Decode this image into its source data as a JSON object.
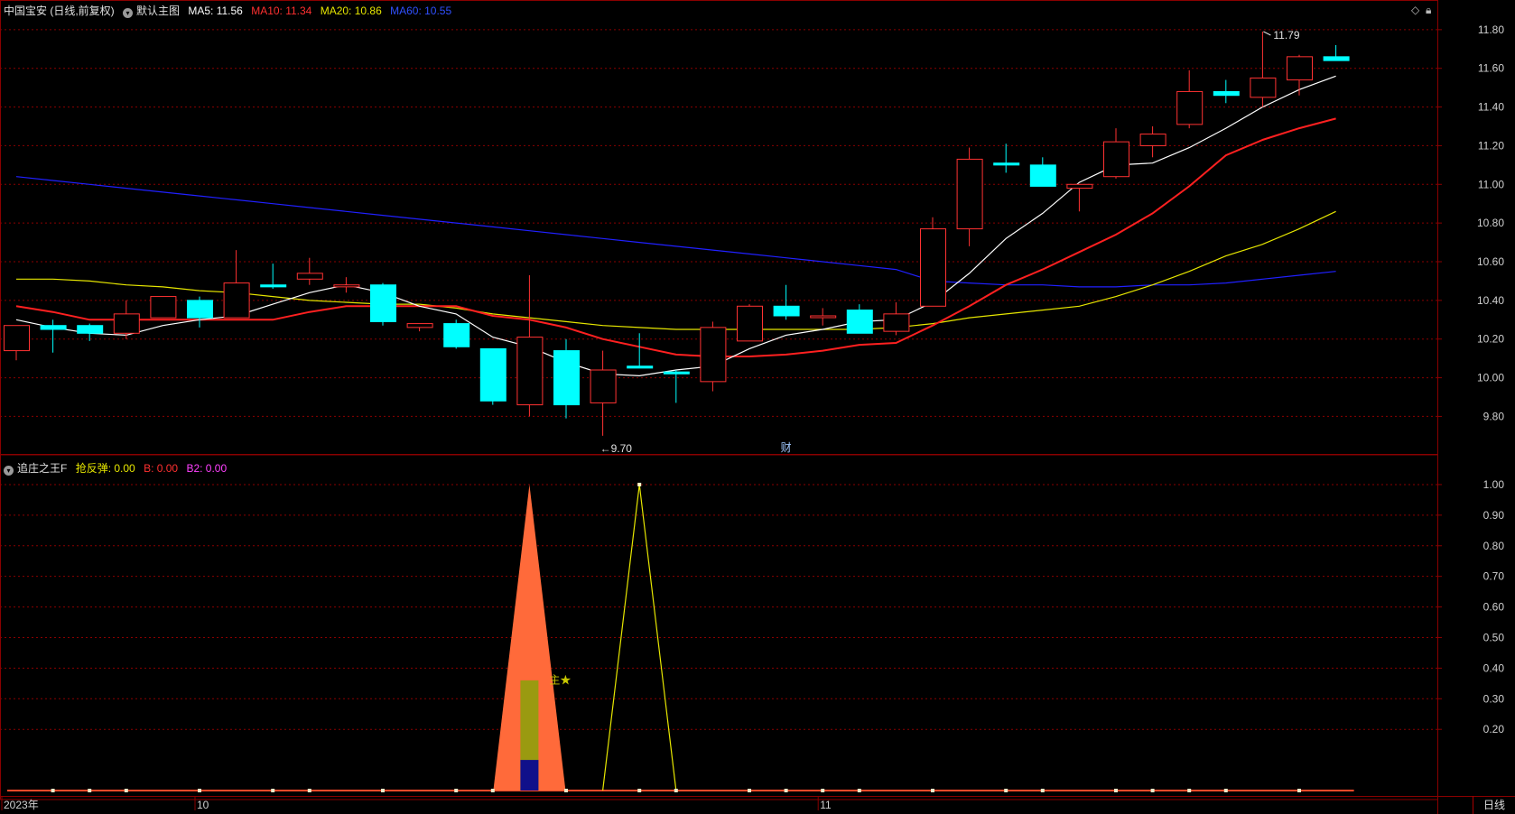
{
  "main_legend": {
    "title": "中国宝安 (日线,前复权)",
    "template": "默认主图",
    "ma5": "MA5: 11.56",
    "ma10": "MA10: 11.34",
    "ma20": "MA20: 10.86",
    "ma60": "MA60: 10.55"
  },
  "sub_legend": {
    "title": "追庄之王F",
    "qfd": "抢反弹: 0.00",
    "b": "B: 0.00",
    "b2": "B2: 0.00"
  },
  "period_label": "日线",
  "icons": [
    "diamond-icon",
    "lock-icon",
    "chevron-down-icon"
  ],
  "colors": {
    "up": "#ff3232",
    "down": "#00ffff",
    "ma5": "#ffffff",
    "ma10": "#ff2020",
    "ma20": "#e6e600",
    "ma60": "#2020ff",
    "grid": "#8a0000"
  },
  "chart_data": {
    "type": "candlestick",
    "price_axis": [
      "11.80",
      "11.60",
      "11.40",
      "11.20",
      "11.00",
      "10.80",
      "10.60",
      "10.40",
      "10.20",
      "10.00",
      "9.80"
    ],
    "price_range": [
      9.62,
      11.86
    ],
    "annotations": {
      "high_label": "11.79",
      "low_label": "←9.70",
      "fin_label": "财",
      "star_label": "主★"
    },
    "date_labels": [
      {
        "text": "2023年",
        "i": 0
      },
      {
        "text": "10",
        "i": 5
      },
      {
        "text": "11",
        "i": 22
      }
    ],
    "candles": [
      {
        "o": 10.14,
        "h": 10.26,
        "l": 10.09,
        "c": 10.27
      },
      {
        "o": 10.27,
        "h": 10.3,
        "l": 10.13,
        "c": 10.25
      },
      {
        "o": 10.27,
        "h": 10.28,
        "l": 10.19,
        "c": 10.23
      },
      {
        "o": 10.23,
        "h": 10.4,
        "l": 10.2,
        "c": 10.33
      },
      {
        "o": 10.31,
        "h": 10.42,
        "l": 10.31,
        "c": 10.42
      },
      {
        "o": 10.4,
        "h": 10.42,
        "l": 10.26,
        "c": 10.31
      },
      {
        "o": 10.31,
        "h": 10.66,
        "l": 10.31,
        "c": 10.49
      },
      {
        "o": 10.48,
        "h": 10.59,
        "l": 10.46,
        "c": 10.47
      },
      {
        "o": 10.51,
        "h": 10.62,
        "l": 10.48,
        "c": 10.54
      },
      {
        "o": 10.47,
        "h": 10.52,
        "l": 10.44,
        "c": 10.48
      },
      {
        "o": 10.48,
        "h": 10.49,
        "l": 10.27,
        "c": 10.29
      },
      {
        "o": 10.26,
        "h": 10.28,
        "l": 10.24,
        "c": 10.28
      },
      {
        "o": 10.28,
        "h": 10.3,
        "l": 10.15,
        "c": 10.16
      },
      {
        "o": 10.15,
        "h": 10.15,
        "l": 9.86,
        "c": 9.88
      },
      {
        "o": 9.86,
        "h": 10.53,
        "l": 9.8,
        "c": 10.21
      },
      {
        "o": 10.14,
        "h": 10.2,
        "l": 9.79,
        "c": 9.86
      },
      {
        "o": 9.87,
        "h": 10.14,
        "l": 9.7,
        "c": 10.04
      },
      {
        "o": 10.06,
        "h": 10.23,
        "l": 10.05,
        "c": 10.05
      },
      {
        "o": 10.03,
        "h": 10.04,
        "l": 9.87,
        "c": 10.02
      },
      {
        "o": 9.98,
        "h": 10.29,
        "l": 9.93,
        "c": 10.26
      },
      {
        "o": 10.19,
        "h": 10.38,
        "l": 10.19,
        "c": 10.37
      },
      {
        "o": 10.37,
        "h": 10.48,
        "l": 10.3,
        "c": 10.32
      },
      {
        "o": 10.32,
        "h": 10.36,
        "l": 10.27,
        "c": 10.32
      },
      {
        "o": 10.35,
        "h": 10.38,
        "l": 10.23,
        "c": 10.23
      },
      {
        "o": 10.24,
        "h": 10.39,
        "l": 10.22,
        "c": 10.33
      },
      {
        "o": 10.37,
        "h": 10.83,
        "l": 10.37,
        "c": 10.77
      },
      {
        "o": 10.77,
        "h": 11.19,
        "l": 10.68,
        "c": 11.13
      },
      {
        "o": 11.11,
        "h": 11.21,
        "l": 11.06,
        "c": 11.1
      },
      {
        "o": 11.1,
        "h": 11.14,
        "l": 10.99,
        "c": 10.99
      },
      {
        "o": 10.98,
        "h": 11.0,
        "l": 10.86,
        "c": 11.0
      },
      {
        "o": 11.04,
        "h": 11.29,
        "l": 11.03,
        "c": 11.22
      },
      {
        "o": 11.2,
        "h": 11.3,
        "l": 11.14,
        "c": 11.26
      },
      {
        "o": 11.31,
        "h": 11.59,
        "l": 11.29,
        "c": 11.48
      },
      {
        "o": 11.48,
        "h": 11.54,
        "l": 11.42,
        "c": 11.46
      },
      {
        "o": 11.45,
        "h": 11.79,
        "l": 11.4,
        "c": 11.55
      },
      {
        "o": 11.54,
        "h": 11.67,
        "l": 11.46,
        "c": 11.66
      },
      {
        "o": 11.66,
        "h": 11.72,
        "l": 11.64,
        "c": 11.64
      }
    ],
    "ma5": [
      10.3,
      10.26,
      10.23,
      10.22,
      10.27,
      10.3,
      10.32,
      10.38,
      10.44,
      10.48,
      10.44,
      10.37,
      10.33,
      10.21,
      10.16,
      10.08,
      10.02,
      10.01,
      10.04,
      10.06,
      10.15,
      10.22,
      10.25,
      10.29,
      10.3,
      10.39,
      10.54,
      10.72,
      10.85,
      11.01,
      11.1,
      11.11,
      11.19,
      11.29,
      11.4,
      11.49,
      11.56
    ],
    "ma10": [
      10.37,
      10.34,
      10.3,
      10.3,
      10.3,
      10.3,
      10.3,
      10.3,
      10.34,
      10.37,
      10.37,
      10.37,
      10.37,
      10.32,
      10.3,
      10.26,
      10.2,
      10.16,
      10.12,
      10.11,
      10.11,
      10.12,
      10.14,
      10.17,
      10.18,
      10.27,
      10.37,
      10.48,
      10.56,
      10.65,
      10.74,
      10.85,
      10.99,
      11.15,
      11.23,
      11.29,
      11.34
    ],
    "ma20": [
      10.51,
      10.51,
      10.5,
      10.48,
      10.47,
      10.45,
      10.44,
      10.42,
      10.4,
      10.39,
      10.38,
      10.38,
      10.36,
      10.33,
      10.31,
      10.29,
      10.27,
      10.26,
      10.25,
      10.25,
      10.25,
      10.25,
      10.25,
      10.25,
      10.26,
      10.28,
      10.31,
      10.33,
      10.35,
      10.37,
      10.42,
      10.48,
      10.55,
      10.63,
      10.69,
      10.77,
      10.86
    ],
    "ma60": [
      11.04,
      11.02,
      11.0,
      10.98,
      10.96,
      10.94,
      10.92,
      10.9,
      10.88,
      10.86,
      10.84,
      10.82,
      10.8,
      10.78,
      10.76,
      10.74,
      10.72,
      10.7,
      10.68,
      10.66,
      10.64,
      10.62,
      10.6,
      10.58,
      10.56,
      10.5,
      10.49,
      10.48,
      10.48,
      10.47,
      10.47,
      10.48,
      10.48,
      10.49,
      10.51,
      10.53,
      10.55
    ],
    "indicator": {
      "range": [
        0,
        1.05
      ],
      "axis": [
        "1.00",
        "0.90",
        "0.80",
        "0.70",
        "0.60",
        "0.50",
        "0.40",
        "0.30",
        "0.20"
      ],
      "qfd_line": [
        0,
        0,
        0,
        0,
        0,
        0,
        0,
        0,
        0,
        0,
        0,
        0,
        0,
        0,
        0,
        0,
        0,
        1,
        0,
        0,
        0,
        0,
        0,
        0,
        0,
        0,
        0,
        0,
        0,
        0,
        0,
        0,
        0,
        0,
        0,
        0,
        0
      ],
      "orange_peak": {
        "i": 14,
        "value": 1.0
      },
      "olive_bar": {
        "i": 14,
        "value": 0.36
      },
      "navy_bar": {
        "i": 14,
        "value": 0.1
      },
      "markers_i": [
        1,
        2,
        3,
        5,
        7,
        8,
        10,
        12,
        13,
        15,
        17,
        18,
        20,
        21,
        22,
        23,
        25,
        27,
        28,
        30,
        31,
        32,
        33,
        35
      ]
    }
  }
}
